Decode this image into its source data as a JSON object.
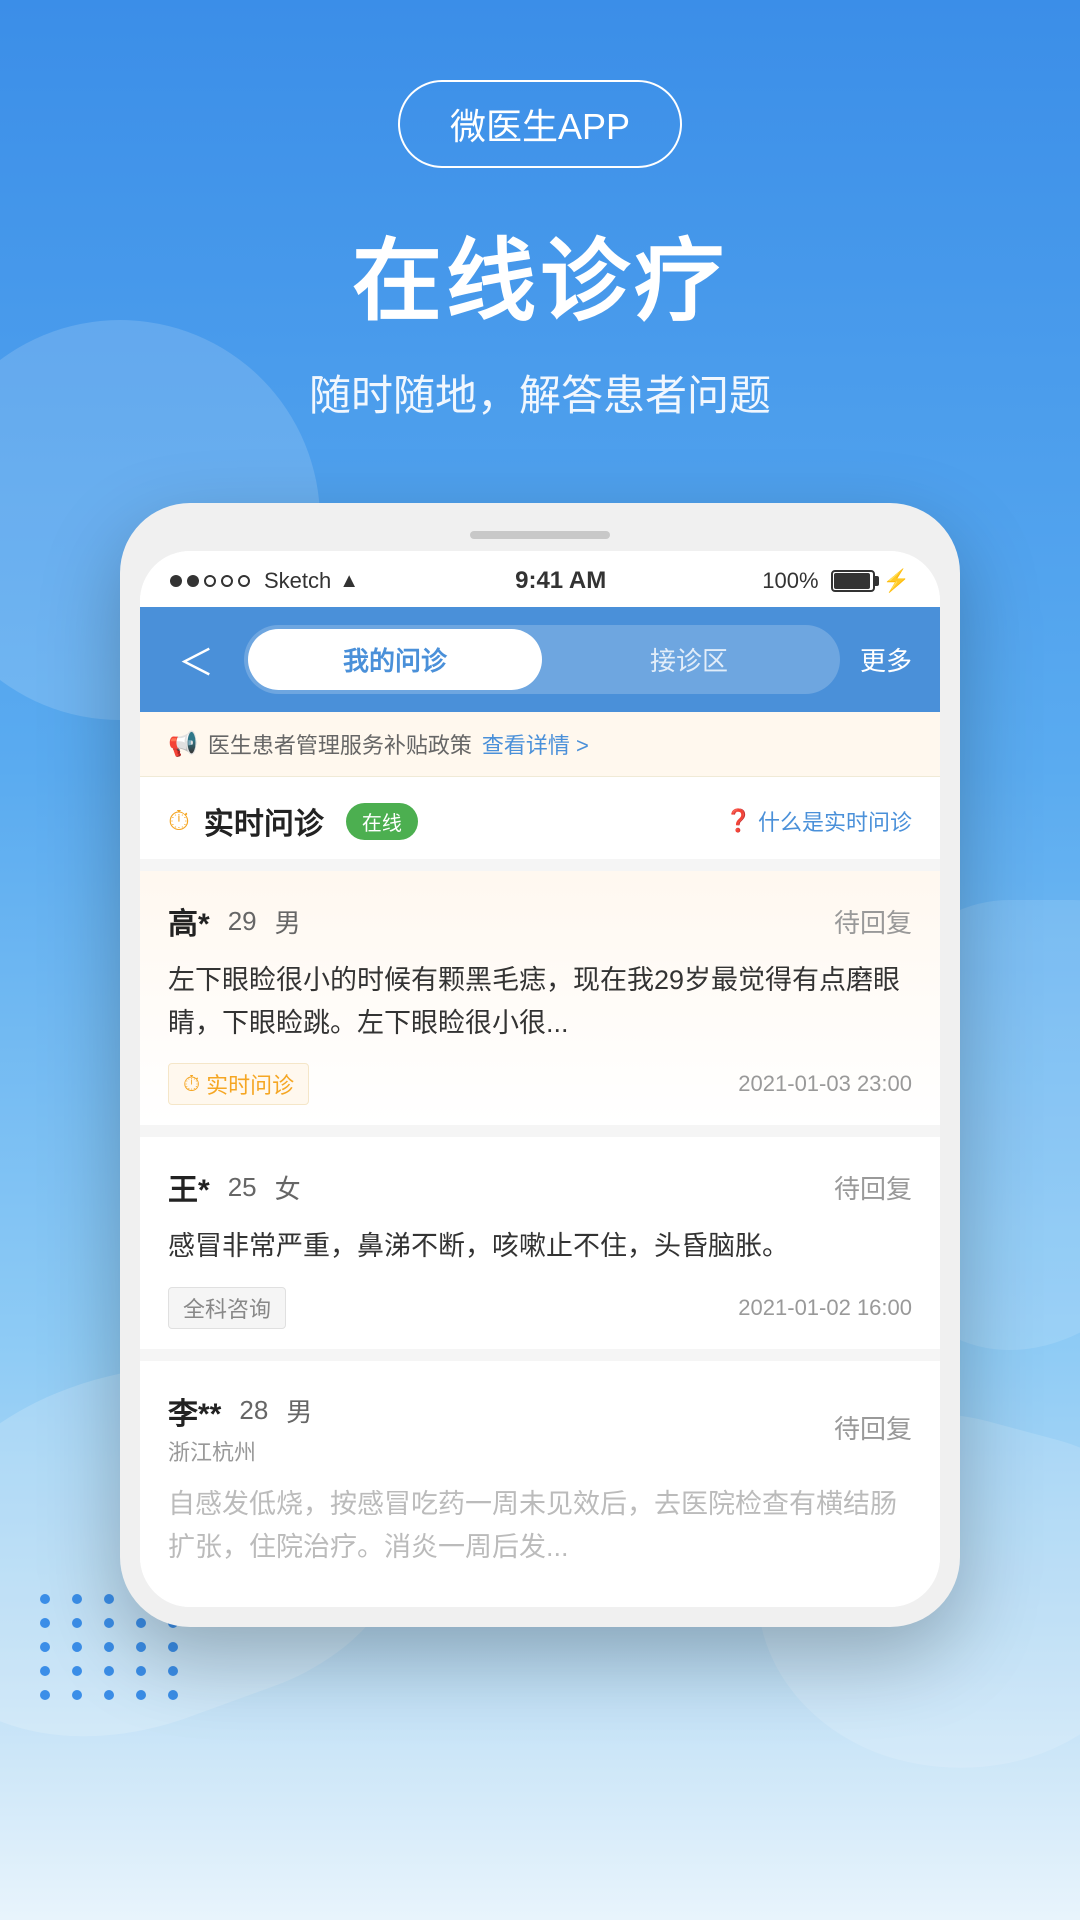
{
  "header": {
    "app_badge": "微医生APP",
    "main_title": "在线诊疗",
    "subtitle": "随时随地，解答患者问题"
  },
  "phone": {
    "status_bar": {
      "left": "●●○○○ Sketch",
      "wifi": "WiFi",
      "time": "9:41 AM",
      "battery_pct": "100%",
      "bolt": "⚡"
    },
    "nav": {
      "back_label": "＜",
      "tab1": "我的问诊",
      "tab2": "接诊区",
      "more_label": "更多"
    },
    "notice": {
      "icon": "📢",
      "text": "医生患者管理服务补贴政策",
      "link": "查看详情 >"
    },
    "realtime_section": {
      "icon": "⏱",
      "title": "实时问诊",
      "badge": "在线",
      "help_icon": "？",
      "help_text": "什么是实时问诊"
    },
    "cards": [
      {
        "name": "高*",
        "age": "29",
        "gender": "男",
        "status": "待回复",
        "content": "左下眼睑很小的时候有颗黑毛痣，现在我29岁最觉得有点磨眼睛，下眼睑跳。左下眼睑很小很...",
        "type": "实时问诊",
        "type_icon": "⏱",
        "time": "2021-01-03 23:00",
        "location": "",
        "highlighted": true
      },
      {
        "name": "王*",
        "age": "25",
        "gender": "女",
        "status": "待回复",
        "content": "感冒非常严重，鼻涕不断，咳嗽止不住，头昏脑胀。",
        "type": "全科咨询",
        "type_icon": "",
        "time": "2021-01-02 16:00",
        "location": "",
        "highlighted": false
      },
      {
        "name": "李**",
        "age": "28",
        "gender": "男",
        "status": "待回复",
        "content": "自感发低烧，按感冒吃药一周未见效后，去医院检查有横结肠扩张，住院治疗。消炎一周后发...",
        "type": "",
        "type_icon": "",
        "time": "",
        "location": "浙江杭州",
        "highlighted": false
      }
    ]
  }
}
